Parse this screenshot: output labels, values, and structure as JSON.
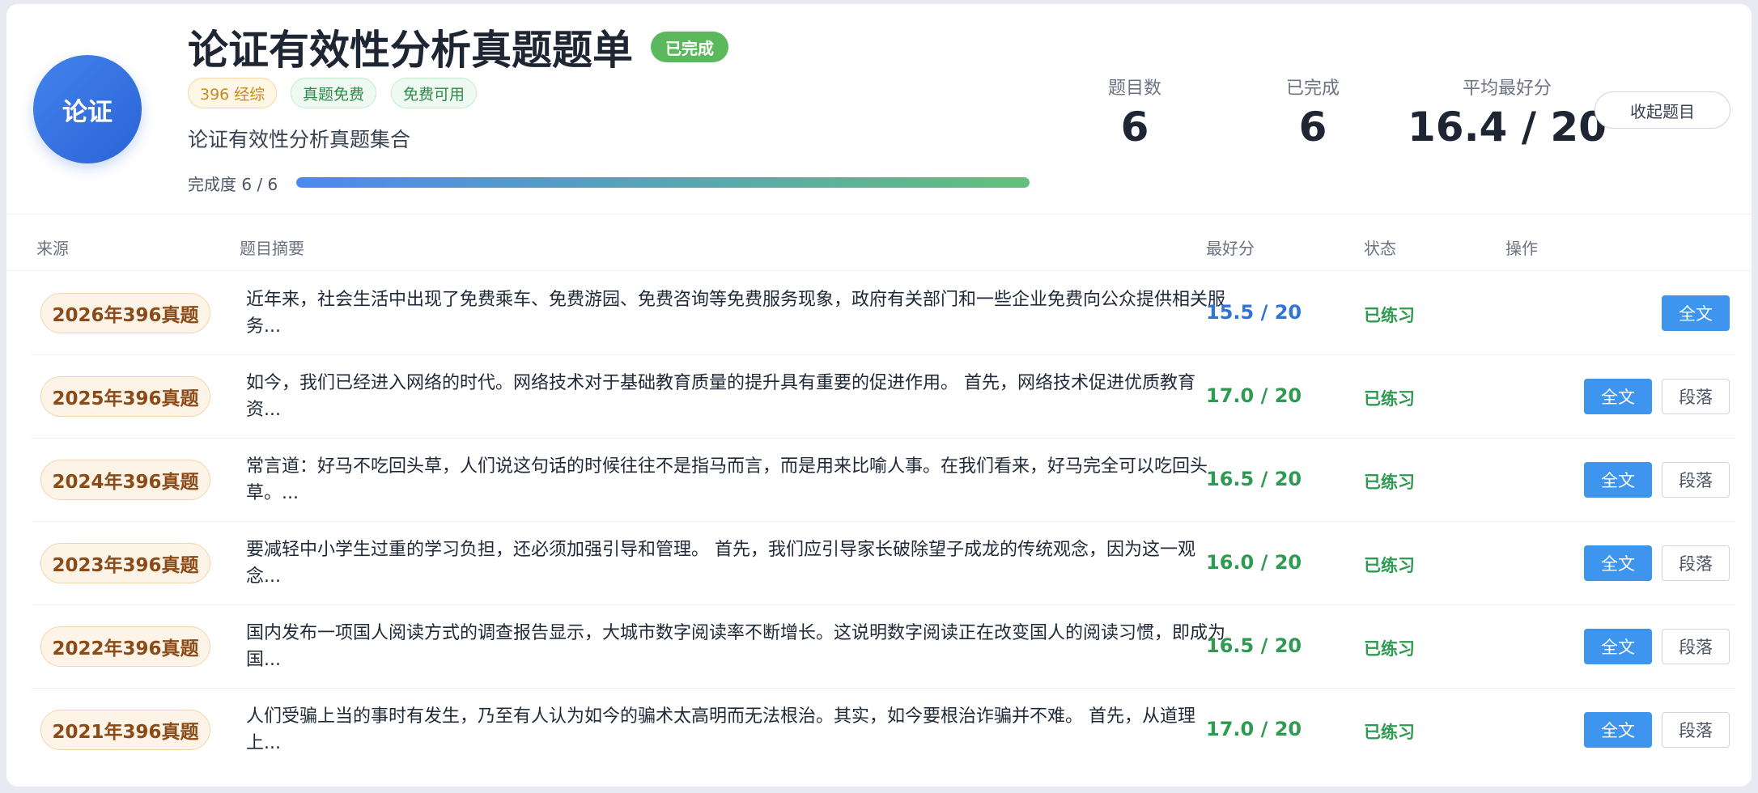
{
  "header": {
    "avatar_text": "论证",
    "title": "论证有效性分析真题题单",
    "done_badge": "已完成",
    "tags": [
      "396 经综",
      "真题免费",
      "免费可用"
    ],
    "subtitle": "论证有效性分析真题集合",
    "progress_label": "完成度 6 / 6",
    "progress_fraction": 1.0,
    "stats": [
      {
        "label": "题目数",
        "value": "6"
      },
      {
        "label": "已完成",
        "value": "6"
      },
      {
        "label": "平均最好分",
        "value": "16.4 / 20"
      }
    ],
    "collapse_label": "收起题目"
  },
  "table": {
    "columns": [
      "来源",
      "题目摘要",
      "最好分",
      "状态",
      "操作"
    ],
    "rows": [
      {
        "source": "2026年396真题",
        "summary": "近年来，社会生活中出现了免费乘车、免费游园、免费咨询等免费服务现象，政府有关部门和一些企业免费向公众提供相关服务...",
        "score": "15.5 / 20",
        "score_color": "#2f74d6",
        "status": "已练习",
        "full_label": "全文",
        "para_label": ""
      },
      {
        "source": "2025年396真题",
        "summary": "如今，我们已经进入网络的时代。网络技术对于基础教育质量的提升具有重要的促进作用。 首先，网络技术促进优质教育资...",
        "score": "17.0 / 20",
        "score_color": "#2f9a52",
        "status": "已练习",
        "full_label": "全文",
        "para_label": "段落"
      },
      {
        "source": "2024年396真题",
        "summary": "常言道：好马不吃回头草，人们说这句话的时候往往不是指马而言，而是用来比喻人事。在我们看来，好马完全可以吃回头草。...",
        "score": "16.5 / 20",
        "score_color": "#2f9a52",
        "status": "已练习",
        "full_label": "全文",
        "para_label": "段落"
      },
      {
        "source": "2023年396真题",
        "summary": "要减轻中小学生过重的学习负担，还必须加强引导和管理。 首先，我们应引导家长破除望子成龙的传统观念，因为这一观念...",
        "score": "16.0 / 20",
        "score_color": "#2f9a52",
        "status": "已练习",
        "full_label": "全文",
        "para_label": "段落"
      },
      {
        "source": "2022年396真题",
        "summary": "国内发布一项国人阅读方式的调查报告显示，大城市数字阅读率不断增长。这说明数字阅读正在改变国人的阅读习惯，即成为国...",
        "score": "16.5 / 20",
        "score_color": "#2f9a52",
        "status": "已练习",
        "full_label": "全文",
        "para_label": "段落"
      },
      {
        "source": "2021年396真题",
        "summary": "人们受骗上当的事时有发生，乃至有人认为如今的骗术太高明而无法根治。其实，如今要根治诈骗并不难。 首先，从道理上...",
        "score": "17.0 / 20",
        "score_color": "#2f9a52",
        "status": "已练习",
        "full_label": "全文",
        "para_label": "段落"
      }
    ]
  }
}
